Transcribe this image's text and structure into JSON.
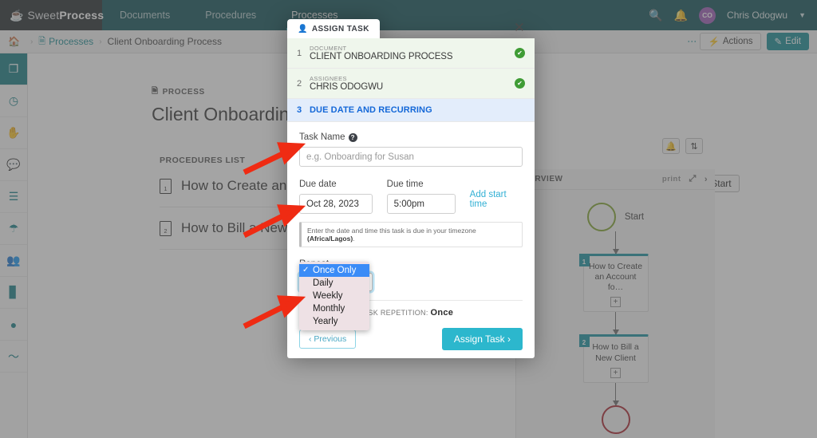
{
  "topnav": {
    "brand": "Sweet",
    "brand_bold": "Process",
    "brand_icon": "leaf-cup-icon",
    "tabs": [
      {
        "label": "Documents",
        "active": false
      },
      {
        "label": "Procedures",
        "active": false
      },
      {
        "label": "Processes",
        "active": true
      }
    ],
    "search_icon": "search-icon",
    "bell_icon": "bell-icon",
    "avatar_initials": "CO",
    "user_name": "Chris Odogwu",
    "caret": "chevron-down-icon"
  },
  "breadcrumb": {
    "home_icon": "home-icon",
    "sep": "›",
    "parent": "Processes",
    "current": "Client Onboarding Process",
    "kebab": "⋮",
    "actions_label": "Actions",
    "actions_icon": "bolt-icon",
    "edit_label": "Edit",
    "edit_icon": "pencil-icon"
  },
  "rail": [
    {
      "name": "documents",
      "glyph": "❐",
      "active": true
    },
    {
      "name": "recent",
      "glyph": "◷",
      "active": false
    },
    {
      "name": "approvals",
      "glyph": "✋",
      "active": false
    },
    {
      "name": "chat",
      "glyph": "💬",
      "active": false
    },
    {
      "name": "tasks",
      "glyph": "☰",
      "active": false
    },
    {
      "name": "policies",
      "glyph": "☂",
      "active": false
    },
    {
      "name": "teams",
      "glyph": "👥",
      "active": false
    },
    {
      "name": "reports",
      "glyph": "▊",
      "active": false
    },
    {
      "name": "status",
      "glyph": "●",
      "active": false
    },
    {
      "name": "signature",
      "glyph": "〜",
      "active": false
    }
  ],
  "document": {
    "kicker": "PROCESS",
    "kicker_icon": "process-icon",
    "title": "Client Onboarding Pr",
    "procedures_header": "PROCEDURES LIST",
    "procedures": [
      {
        "num": "1",
        "name": "How to Create an Ac"
      },
      {
        "num": "2",
        "name": "How to Bill a New Cl"
      }
    ]
  },
  "float_buttons": [
    {
      "name": "notify-button",
      "glyph": "🔔"
    },
    {
      "name": "sort-button",
      "glyph": "⇅"
    }
  ],
  "start_button": {
    "label": "Start",
    "icon": "play-icon"
  },
  "overview": {
    "title": "VERVIEW",
    "print": "print",
    "expand_icon": "expand-icon",
    "next_icon": "chevron-right-icon",
    "start_label": "Start",
    "nodes": [
      {
        "num": "1",
        "label": "How to Create an Account fo…",
        "plus": "+"
      },
      {
        "num": "2",
        "label": "How to Bill a New Client",
        "plus": "+"
      }
    ]
  },
  "modal": {
    "tab_label": "ASSIGN TASK",
    "tab_icon": "person-icon",
    "close_icon": "close-icon",
    "close_glyph": "✕",
    "steps": [
      {
        "n": "1",
        "kicker": "DOCUMENT",
        "value": "CLIENT ONBOARDING PROCESS",
        "state": "done",
        "check": "✔"
      },
      {
        "n": "2",
        "kicker": "ASSIGNEES",
        "value": "CHRIS ODOGWU",
        "state": "done",
        "check": "✔"
      },
      {
        "n": "3",
        "kicker": "",
        "value": "DUE DATE AND RECURRING",
        "state": "current",
        "check": ""
      }
    ],
    "task_name_label": "Task Name",
    "help_icon": "question-icon",
    "task_name_value": "",
    "task_name_placeholder": "e.g. Onboarding for Susan",
    "due_date_label": "Due date",
    "due_date_value": "Oct 28, 2023",
    "due_time_label": "Due time",
    "due_time_value": "5:00pm",
    "add_start_time": "Add start time",
    "hint_text": "Enter the date and time this task is due in your timezone ",
    "hint_tz": "(Africa/Lagos)",
    "hint_tail": ".",
    "repeat_label": "Repeat",
    "repeat_selected": "Once Only",
    "repeat_options": [
      "Once Only",
      "Daily",
      "Weekly",
      "Monthly",
      "Yearly"
    ],
    "repetition_label": "TASK REPETITION:",
    "repetition_value": "Once",
    "previous_label": "‹ Previous",
    "assign_label": "Assign Task ›"
  },
  "colors": {
    "brand_dark": "#23282c",
    "nav_teal": "#0d4f54",
    "accent": "#2cb7cd",
    "link": "#178b92",
    "step_done_bg": "#eff6ec",
    "step_current_bg": "#e3edfb",
    "check_green": "#3f9c35",
    "annotation_red": "#ef2b13",
    "dropdown_highlight": "#3b8cf7",
    "avatar_purple": "#9b59b6"
  }
}
